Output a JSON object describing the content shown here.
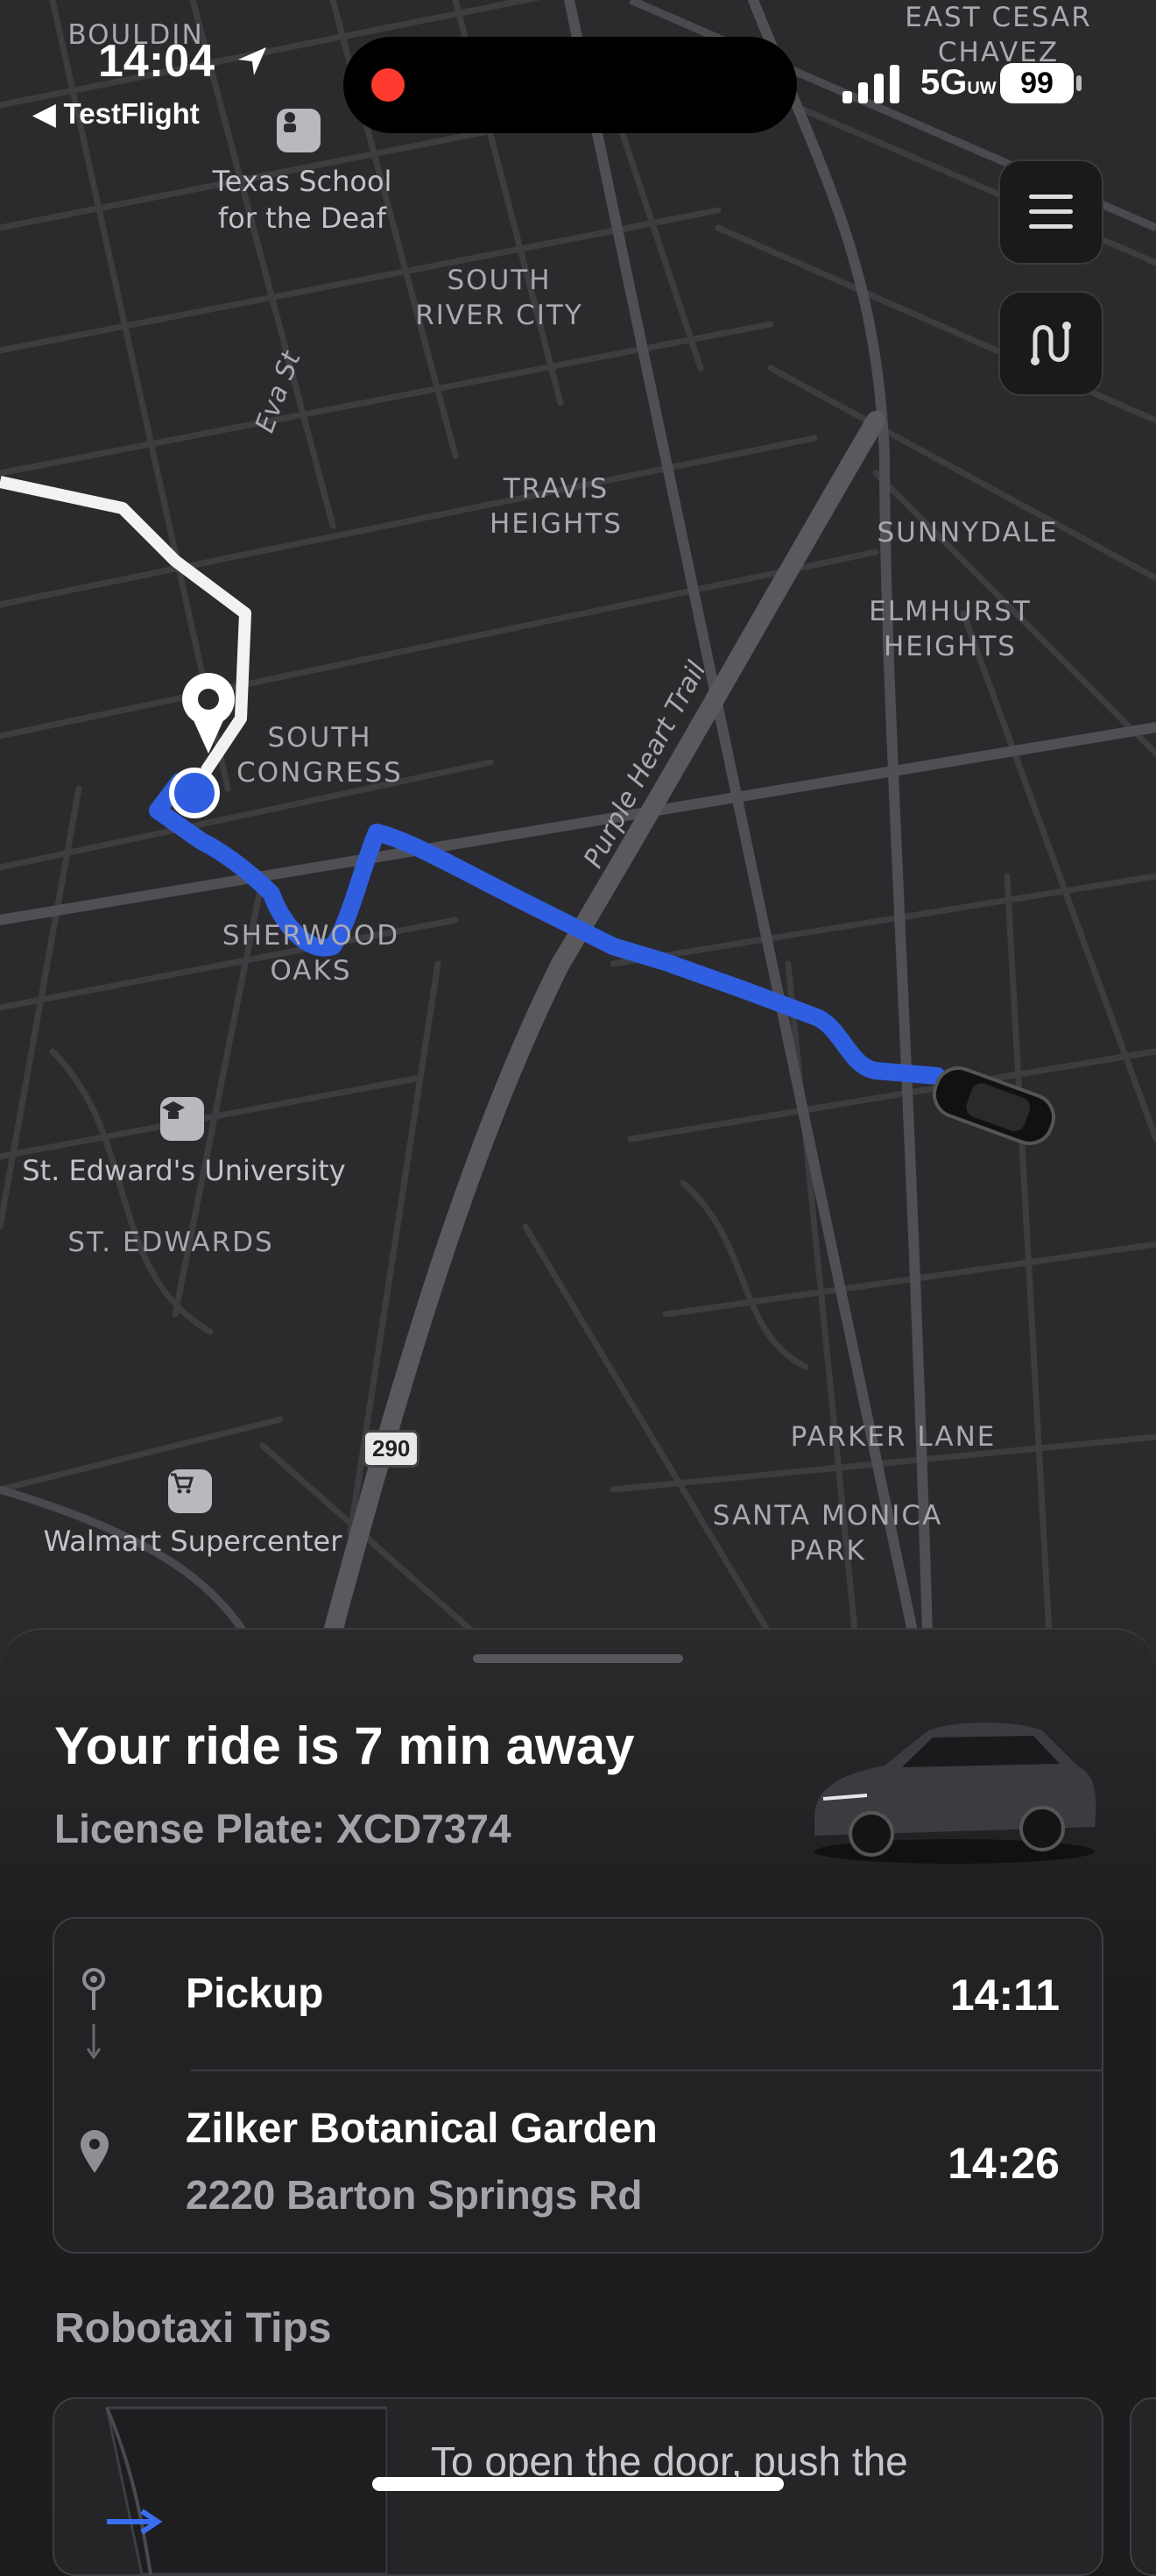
{
  "status_bar": {
    "time": "14:04",
    "back_app": "◀ TestFlight",
    "network": "5G",
    "network_suffix": "UW",
    "battery": "99"
  },
  "map": {
    "neighborhoods": [
      "BOULDIN",
      "EAST CESAR CHAVEZ",
      "SOUTH RIVER CITY",
      "TRAVIS HEIGHTS",
      "SUNNYDALE",
      "ELMHURST HEIGHTS",
      "SOUTH CONGRESS",
      "SHERWOOD OAKS",
      "ST. EDWARDS",
      "PARKER LANE",
      "SANTA MONICA PARK"
    ],
    "poi": {
      "school": "Texas School for the Deaf",
      "university": "St. Edward's University",
      "walmart": "Walmart Supercenter"
    },
    "roads": {
      "eva_st": "Eva St",
      "purple_heart": "Purple Heart Trail",
      "hwy_290": "290"
    },
    "route_color": "#2f5fe0",
    "walk_color": "#f2f2f2"
  },
  "buttons": {
    "menu_icon": "menu-icon",
    "route_icon": "route-icon"
  },
  "ride": {
    "eta": "Your ride is 7 min away",
    "plate": "License Plate: XCD7374",
    "pickup_label": "Pickup",
    "pickup_time": "14:11",
    "dest_name": "Zilker Botanical Garden",
    "dest_address": "2220 Barton Springs Rd",
    "dest_time": "14:26"
  },
  "tips": {
    "title": "Robotaxi Tips",
    "first_tip": "To open the door, push the"
  }
}
